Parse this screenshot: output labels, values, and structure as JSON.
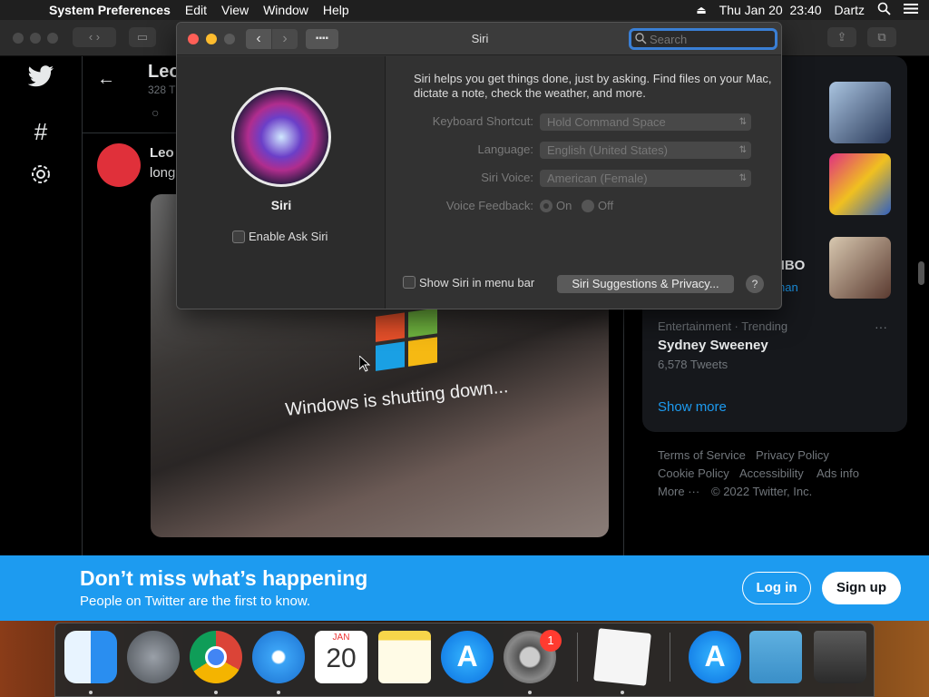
{
  "menubar": {
    "app_name": "System Preferences",
    "items": [
      "Edit",
      "View",
      "Window",
      "Help"
    ],
    "datetime": "Thu Jan 20  23:40",
    "user": "Dartz"
  },
  "twitter": {
    "header_name": "Leo",
    "header_sub": "328 T",
    "tweet_author": "Leo",
    "tweet_text": "long",
    "photo_text": "Windows is shutting down...",
    "trend_right_fragment": "HBO",
    "trend_right_fragment2": "han",
    "trend_category": "Entertainment · Trending",
    "trend_name": "Sydney Sweeney",
    "trend_count": "6,578 Tweets",
    "show_more": "Show more",
    "footer_links": [
      "Terms of Service",
      "Privacy Policy",
      "Cookie Policy",
      "Accessibility",
      "Ads info",
      "More ···",
      "© 2022 Twitter, Inc."
    ],
    "banner_title": "Don’t miss what’s happening",
    "banner_sub": "People on Twitter are the first to know.",
    "login_label": "Log in",
    "signup_label": "Sign up"
  },
  "siri_window": {
    "title": "Siri",
    "search_placeholder": "Search",
    "pane_name": "Siri",
    "enable_label": "Enable Ask Siri",
    "description": "Siri helps you get things done, just by asking. Find files on your Mac, dictate a note, check the weather, and more.",
    "keyboard_label": "Keyboard Shortcut:",
    "keyboard_value": "Hold Command Space",
    "language_label": "Language:",
    "language_value": "English (United States)",
    "voice_label": "Siri Voice:",
    "voice_value": "American (Female)",
    "feedback_label": "Voice Feedback:",
    "feedback_on": "On",
    "feedback_off": "Off",
    "menubar_label": "Show Siri in menu bar",
    "suggestions_button": "Siri Suggestions & Privacy...",
    "help_label": "?"
  },
  "dock": {
    "calendar_month": "JAN",
    "calendar_day": "20",
    "badge_count": "1"
  },
  "colors": {
    "twitter_blue": "#1d9bf0",
    "window_bg": "#323232",
    "close": "#ff5f57",
    "minimize": "#febc2e"
  }
}
